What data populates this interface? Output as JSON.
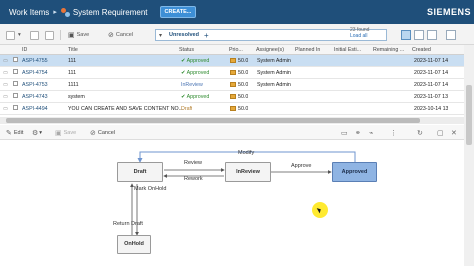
{
  "header": {
    "title": "Work Items",
    "breadcrumb_sep": "▸",
    "subtitle": "System Requirement",
    "create_label": "CREATE...",
    "brand": "SIEMENS"
  },
  "toolbar": {
    "save_label": "Save",
    "cancel_label": "Cancel",
    "filter_value": "Unresolved",
    "filter_plus": "+",
    "found_text": "23 found",
    "load_all": "Load all"
  },
  "table": {
    "headers": [
      "ID",
      "Title",
      "Status",
      "Prio...",
      "Assignee(s)",
      "Planned In",
      "Initial Esti...",
      "Remaining ...",
      "Created"
    ],
    "rows": [
      {
        "id": "ASPI-4755",
        "title": "111",
        "status": "✔ Approved",
        "prio": "50.0",
        "assignee": "System Admin",
        "created": "2023-11-07 14",
        "sel": true,
        "st": "ok"
      },
      {
        "id": "ASPI-4754",
        "title": "111",
        "status": "✔ Approved",
        "prio": "50.0",
        "assignee": "System Admin",
        "created": "2023-11-07 14",
        "sel": false,
        "st": "ok"
      },
      {
        "id": "ASPI-4753",
        "title": "1111",
        "status": "InReview",
        "prio": "50.0",
        "assignee": "System Admin",
        "created": "2023-11-07 14",
        "sel": false,
        "st": "rev"
      },
      {
        "id": "ASPI-4743",
        "title": "system",
        "status": "✔ Approved",
        "prio": "50.0",
        "assignee": "",
        "created": "2023-11-07 13",
        "sel": false,
        "st": "ok"
      },
      {
        "id": "ASPI-4494",
        "title": "YOU CAN CREATE AND SAVE CONTENT NO...",
        "status": "Draft",
        "prio": "50.0",
        "assignee": "",
        "created": "2023-10-14 13",
        "sel": false,
        "st": "dr"
      }
    ]
  },
  "detail_toolbar": {
    "edit_label": "Edit",
    "save_label": "Save",
    "cancel_label": "Cancel"
  },
  "workflow": {
    "nodes": {
      "draft": "Draft",
      "inreview": "InReview",
      "approved": "Approved",
      "onhold": "OnHold"
    },
    "edges": {
      "modify": "Modify",
      "review": "Review",
      "rework": "Rework",
      "approve": "Approve",
      "mark_onhold": "Mark OnHold",
      "return_draft": "Return Draft"
    }
  },
  "colors": {
    "header_bg": "#1f4f7a",
    "selected_row": "#c9def2",
    "approved_node": "#8fb4e3",
    "workflow_edge": "#6f95cf"
  }
}
